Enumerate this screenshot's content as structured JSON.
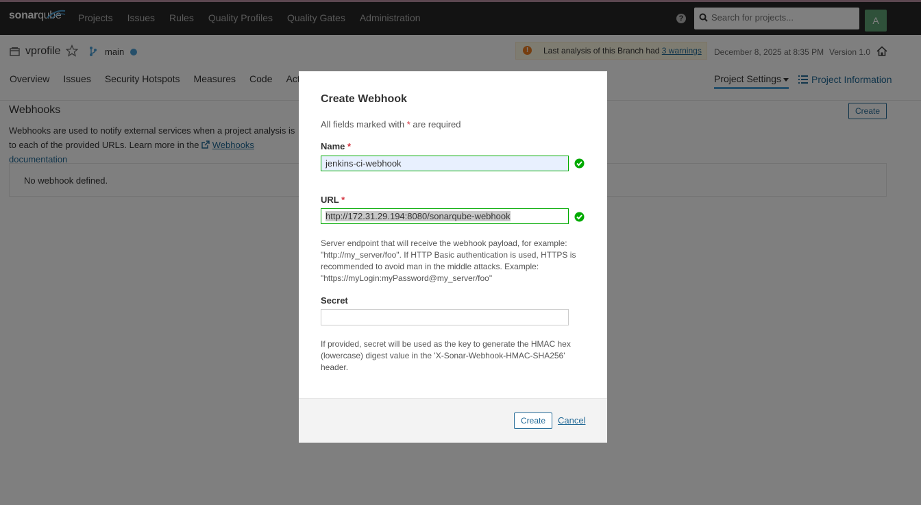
{
  "navbar": {
    "logo_bold": "sonar",
    "logo_light": "qube",
    "items": [
      "Projects",
      "Issues",
      "Rules",
      "Quality Profiles",
      "Quality Gates",
      "Administration"
    ],
    "search_placeholder": "Search for projects...",
    "avatar_letter": "A"
  },
  "project": {
    "name": "vprofile",
    "branch": "main",
    "warning_prefix": "Last analysis of this Branch had",
    "warning_link": "3 warnings",
    "last_analysis": "December 8, 2025 at 8:35 PM",
    "version": "Version 1.0",
    "tabs": [
      "Overview",
      "Issues",
      "Security Hotspots",
      "Measures",
      "Code",
      "Activity"
    ],
    "settings_tab": "Project Settings",
    "info_tab": "Project Information"
  },
  "page": {
    "title": "Webhooks",
    "desc_line1": "Webhooks are used to notify external services when a project analysis is",
    "desc_line2_prefix": "to each of the provided URLs. Learn more in the",
    "desc_link": "Webhooks documentation",
    "create_label": "Create",
    "empty_text": "No webhook defined."
  },
  "modal": {
    "title": "Create Webhook",
    "req_prefix": "All fields marked with",
    "req_star": "*",
    "req_suffix": "are required",
    "name_label": "Name",
    "name_value": "jenkins-ci-webhook",
    "url_label": "URL",
    "url_value": "http://172.31.29.194:8080/sonarqube-webhook",
    "url_help": "Server endpoint that will receive the webhook payload, for example: \"http://my_server/foo\". If HTTP Basic authentication is used, HTTPS is recommended to avoid man in the middle attacks. Example: \"https://myLogin:myPassword@my_server/foo\"",
    "secret_label": "Secret",
    "secret_value": "",
    "secret_help": "If provided, secret will be used as the key to generate the HMAC hex (lowercase) digest value in the 'X-Sonar-Webhook-HMAC-SHA256' header.",
    "create_button": "Create",
    "cancel_button": "Cancel"
  },
  "colors": {
    "navbar_bg": "#262626",
    "link": "#236a97",
    "valid": "#00aa00",
    "required": "#d4333f",
    "warning": "#ed7d20"
  }
}
